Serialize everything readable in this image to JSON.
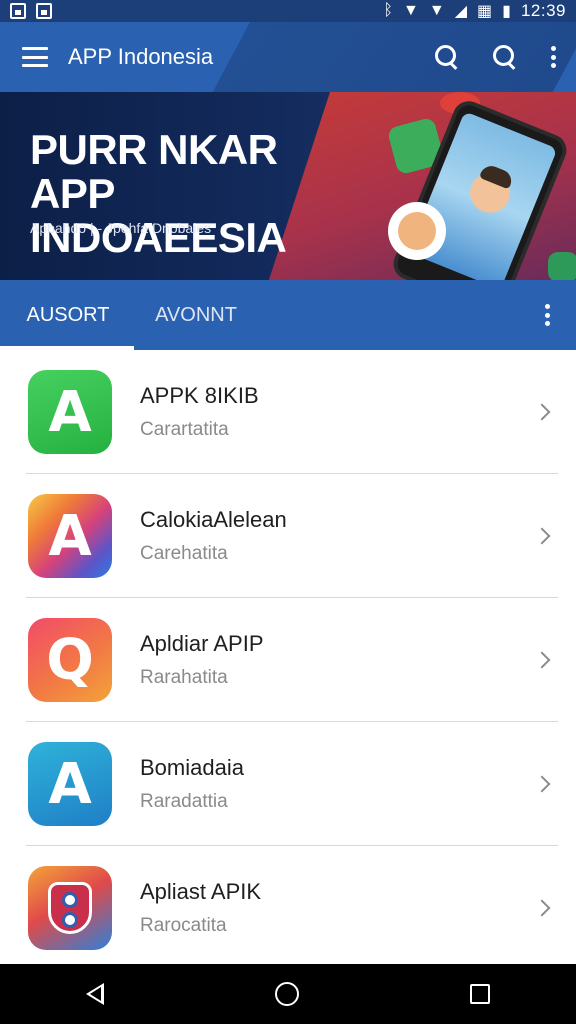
{
  "status_bar": {
    "time": "12:39",
    "left_icons": [
      "image-icon",
      "app-notification-icon"
    ],
    "right_icons": [
      "bluetooth-icon",
      "wifi-icon",
      "wifi-icon",
      "signal-icon",
      "data-icon",
      "battery-icon"
    ]
  },
  "app_bar": {
    "title": "APP Indonesia",
    "actions": [
      "search-icon",
      "search-icon",
      "more-vert-icon"
    ],
    "menu_icon": "menu-icon"
  },
  "banner": {
    "title": "PURR NKAR APP INDOAEESIA",
    "subtitle": "Apbahdo | - Jpehfa Dnobaies"
  },
  "tabs": [
    {
      "label": "AUSORT",
      "selected": true
    },
    {
      "label": "AVONNT",
      "selected": false
    }
  ],
  "apps": [
    {
      "title": "APPK 8IKIB",
      "subtitle": "Carartatita",
      "icon": "A",
      "icon_color": "#2fbf4a"
    },
    {
      "title": "CalokiaAlelean",
      "subtitle": "Carehatita",
      "icon": "A",
      "icon_color": "#d6427b"
    },
    {
      "title": "Apldiar APIP",
      "subtitle": "Rarahatita",
      "icon": "Q",
      "icon_color": "#f27745"
    },
    {
      "title": "Bomiadaia",
      "subtitle": "Raradattia",
      "icon": "A",
      "icon_color": "#1f8ed0"
    },
    {
      "title": "Apliast APIK",
      "subtitle": "Rarocatita",
      "icon": "shield",
      "icon_color": "#e04a4a"
    }
  ],
  "colors": {
    "primary": "#2a61b0",
    "status_bar": "#1c3f7a",
    "banner": "#0c1f47"
  }
}
